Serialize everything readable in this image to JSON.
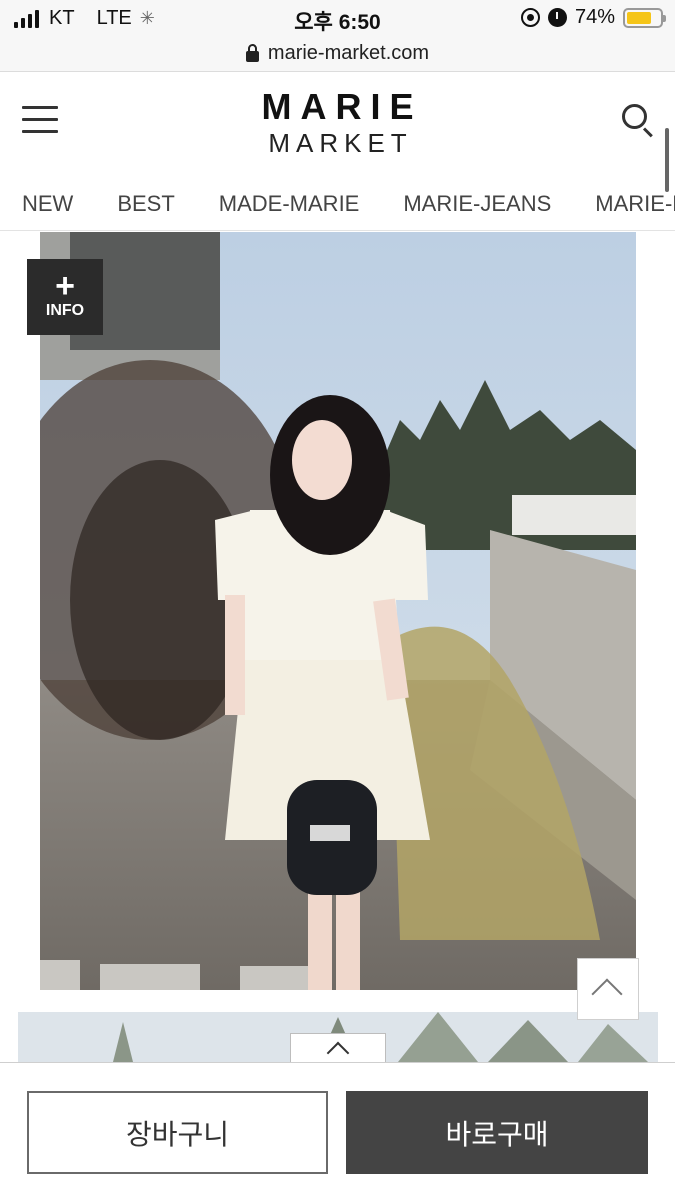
{
  "status_bar": {
    "carrier": "KT",
    "network": "LTE",
    "time": "오후 6:50",
    "battery_percent": "74%",
    "battery_level": 0.74,
    "battery_color": "#f5c518"
  },
  "browser": {
    "url": "marie-market.com"
  },
  "header": {
    "logo_line1": "MARIE",
    "logo_line2": "MARKET"
  },
  "nav": {
    "items": [
      "NEW",
      "BEST",
      "MADE-MARIE",
      "MARIE-JEANS",
      "MARIE-P"
    ]
  },
  "product": {
    "info_button_label": "INFO"
  },
  "actions": {
    "cart_label": "장바구니",
    "buy_label": "바로구매",
    "buy_bg_color": "#444444"
  },
  "icons": {
    "menu": "hamburger-icon",
    "search": "search-icon",
    "info_plus": "plus-icon",
    "scroll_top": "chevron-up-icon",
    "drawer": "chevron-up-icon"
  }
}
